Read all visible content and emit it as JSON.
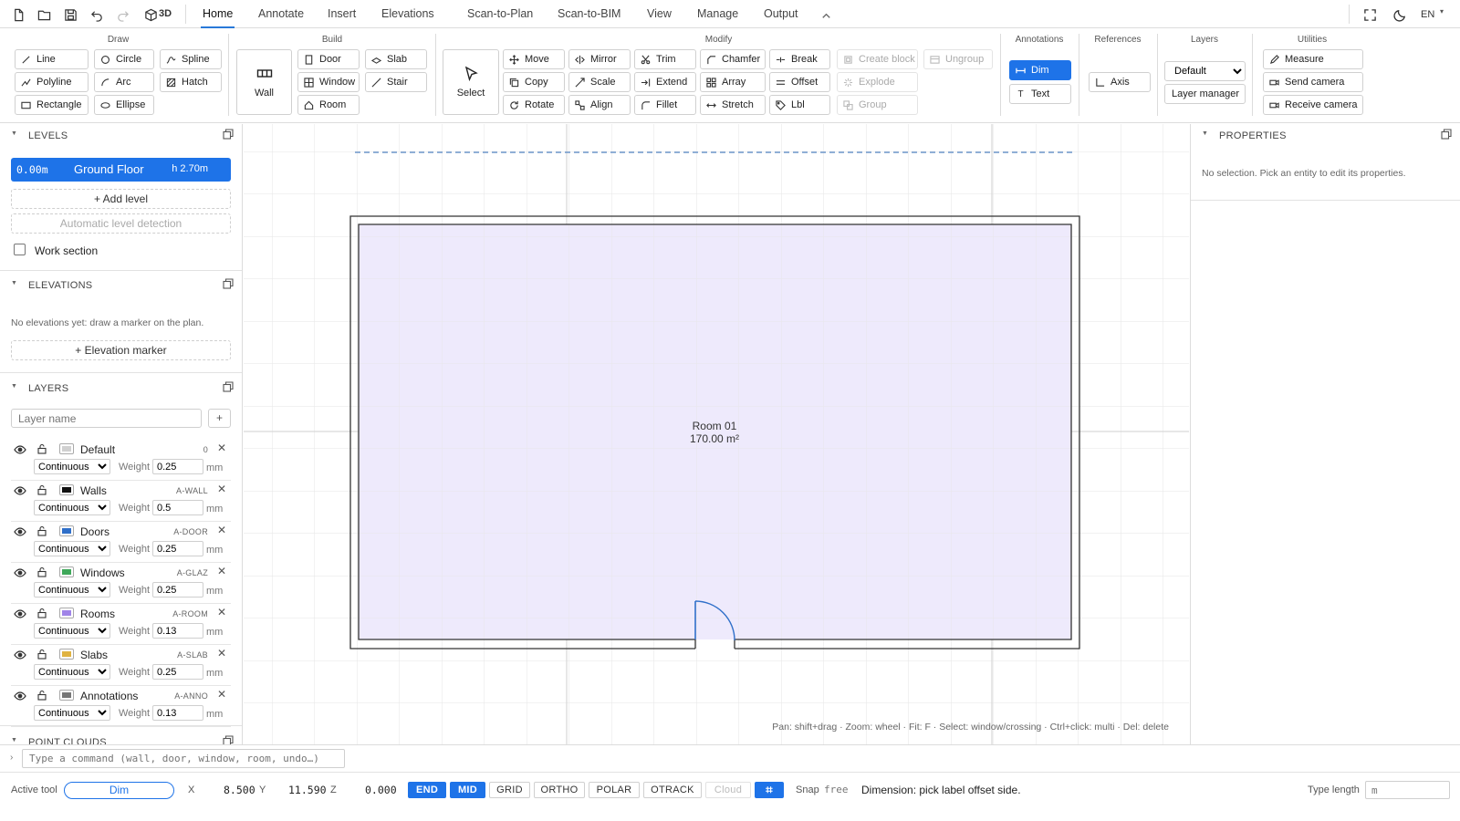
{
  "topbar": {
    "view3d_label": "3D",
    "tabs": [
      {
        "label": "Home",
        "active": true
      },
      {
        "label": "Annotate"
      },
      {
        "label": "Insert"
      },
      {
        "label": "Elevations"
      },
      {
        "label": "Scan-to-Plan"
      },
      {
        "label": "Scan-to-BIM"
      },
      {
        "label": "View"
      },
      {
        "label": "Manage"
      },
      {
        "label": "Output"
      }
    ],
    "language": "EN"
  },
  "ribbon": {
    "draw": {
      "title": "Draw",
      "buttons": [
        "Line",
        "Circle",
        "Spline",
        "Polyline",
        "Arc",
        "Hatch",
        "Rectangle",
        "Ellipse"
      ]
    },
    "build": {
      "title": "Build",
      "wall": "Wall",
      "buttons": [
        "Door",
        "Slab",
        "Window",
        "Stair",
        "Room"
      ]
    },
    "modify": {
      "title": "Modify",
      "select": "Select",
      "buttons": [
        "Move",
        "Mirror",
        "Trim",
        "Chamfer",
        "Break",
        "Copy",
        "Scale",
        "Extend",
        "Array",
        "Offset",
        "Rotate",
        "Align",
        "Fillet",
        "Stretch",
        "Lbl"
      ],
      "disabled": [
        "Create block",
        "Ungroup",
        "Explode",
        "Group"
      ]
    },
    "annotations": {
      "title": "Annotations",
      "dim": "Dim",
      "text": "Text"
    },
    "references": {
      "title": "References",
      "axis": "Axis"
    },
    "layers": {
      "title": "Layers",
      "current": "Default",
      "manager": "Layer manager"
    },
    "utilities": {
      "title": "Utilities",
      "buttons": [
        "Measure",
        "Send camera",
        "Receive camera"
      ]
    }
  },
  "left": {
    "levels": {
      "title": "LEVELS",
      "level": {
        "elev": "0.00m",
        "name": "Ground Floor",
        "height": "h 2.70m"
      },
      "add": "+ Add level",
      "auto": "Automatic level detection",
      "work_section": "Work section"
    },
    "elevations": {
      "title": "ELEVATIONS",
      "empty": "No elevations yet: draw a marker on the plan.",
      "add": "+ Elevation marker"
    },
    "layers": {
      "title": "LAYERS",
      "placeholder": "Layer name",
      "add": "+",
      "weight_label": "Weight",
      "unit": "mm",
      "items": [
        {
          "name": "Default",
          "code": "0",
          "color": "#d0d0d0",
          "linetype": "Continuous",
          "weight": "0.25"
        },
        {
          "name": "Walls",
          "code": "A-WALL",
          "color": "#111111",
          "linetype": "Continuous",
          "weight": "0.5"
        },
        {
          "name": "Doors",
          "code": "A-DOOR",
          "color": "#2f6fc9",
          "linetype": "Continuous",
          "weight": "0.25"
        },
        {
          "name": "Windows",
          "code": "A-GLAZ",
          "color": "#3fa85a",
          "linetype": "Continuous",
          "weight": "0.25"
        },
        {
          "name": "Rooms",
          "code": "A-ROOM",
          "color": "#a084e8",
          "linetype": "Continuous",
          "weight": "0.13"
        },
        {
          "name": "Slabs",
          "code": "A-SLAB",
          "color": "#e0b341",
          "linetype": "Continuous",
          "weight": "0.25"
        },
        {
          "name": "Annotations",
          "code": "A-ANNO",
          "color": "#777777",
          "linetype": "Continuous",
          "weight": "0.13"
        }
      ]
    },
    "point_clouds": {
      "title": "POINT CLOUDS"
    }
  },
  "canvas": {
    "room_name": "Room 01",
    "room_area": "170.00 m²",
    "hint": "Pan: shift+drag · Zoom: wheel · Fit: F · Select: window/crossing · Ctrl+click: multi · Del: delete"
  },
  "properties": {
    "title": "PROPERTIES",
    "empty": "No selection. Pick an entity to edit its properties."
  },
  "command": {
    "placeholder": "Type a command (wall, door, window, room, undo…)"
  },
  "status": {
    "active_tool_label": "Active tool",
    "active_tool": "Dim",
    "x_label": "X",
    "x": "8.500",
    "y_label": "Y",
    "y": "11.590",
    "z_label": "Z",
    "z": "0.000",
    "toggles": [
      {
        "label": "END",
        "on": true
      },
      {
        "label": "MID",
        "on": true
      },
      {
        "label": "GRID",
        "on": false
      },
      {
        "label": "ORTHO",
        "on": false
      },
      {
        "label": "POLAR",
        "on": false
      },
      {
        "label": "OTRACK",
        "on": false
      },
      {
        "label": "Cloud",
        "disabled": true
      }
    ],
    "snap_label": "Snap",
    "snap_value": "free",
    "message": "Dimension: pick label offset side.",
    "type_length_label": "Type length",
    "type_length_value": "m"
  },
  "colors": {
    "accent": "#1e73e8",
    "room_fill": "#eeeafc",
    "door": "#2f6fc9"
  }
}
